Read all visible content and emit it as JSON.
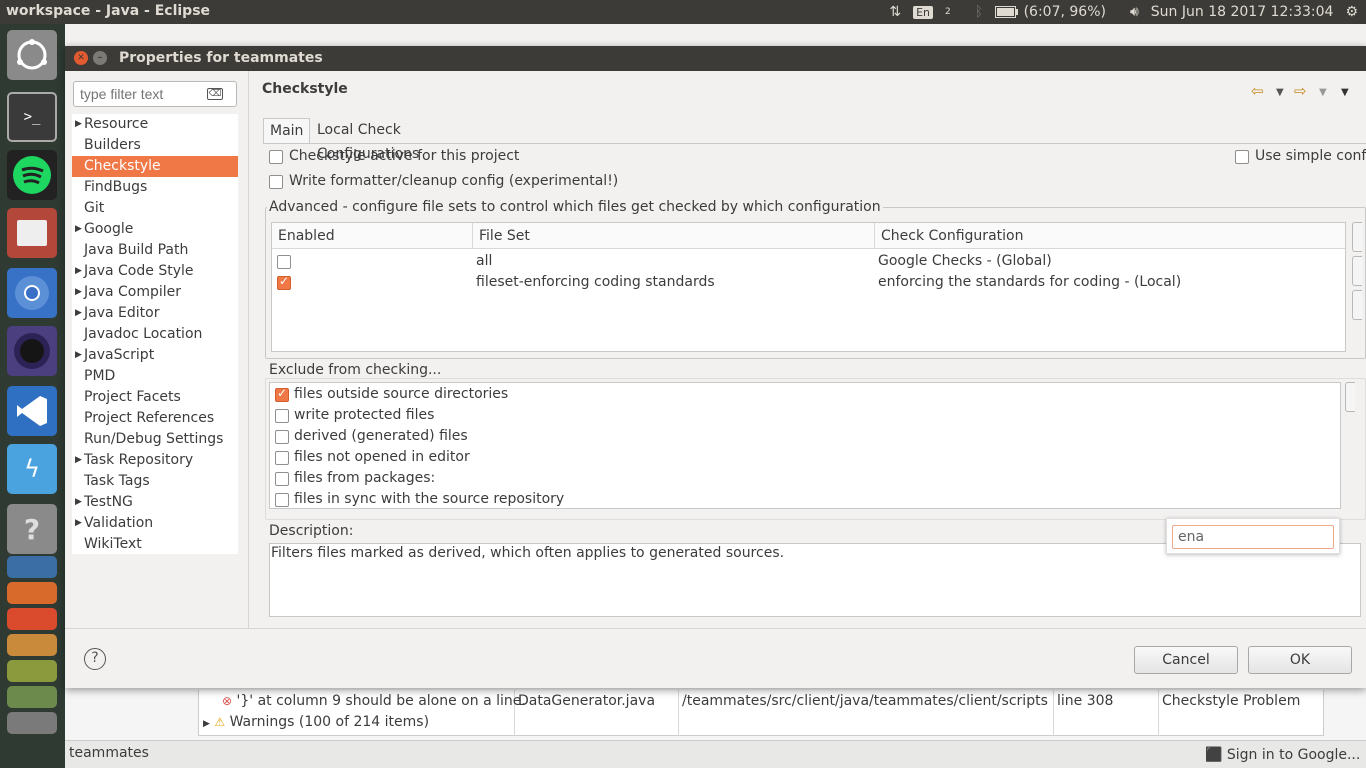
{
  "top_bar": {
    "window_title": "workspace - Java - Eclipse",
    "keyboard_layout": "En",
    "keyboard_sub": "2",
    "battery": "(6:07, 96%)",
    "datetime": "Sun Jun 18 2017 12:33:04"
  },
  "launcher": {
    "apps": [
      "ubuntu-dash-icon",
      "terminal-icon",
      "spotify-icon",
      "files-icon",
      "chromium-icon",
      "eclipse-icon",
      "vscode-icon",
      "storm-icon",
      "help-icon",
      "libreoffice-icon",
      "firefox-icon",
      "software-center-icon",
      "impress-icon",
      "settings-icon",
      "disk-icon",
      "trash-icon"
    ]
  },
  "dialog": {
    "title": "Properties for teammates",
    "filter_placeholder": "type filter text",
    "filter_clear": "⌫",
    "tree_items": [
      {
        "label": "Resource",
        "expandable": true
      },
      {
        "label": "Builders",
        "expandable": false
      },
      {
        "label": "Checkstyle",
        "expandable": false,
        "selected": true
      },
      {
        "label": "FindBugs",
        "expandable": false
      },
      {
        "label": "Git",
        "expandable": false
      },
      {
        "label": "Google",
        "expandable": true
      },
      {
        "label": "Java Build Path",
        "expandable": false
      },
      {
        "label": "Java Code Style",
        "expandable": true
      },
      {
        "label": "Java Compiler",
        "expandable": true
      },
      {
        "label": "Java Editor",
        "expandable": true
      },
      {
        "label": "Javadoc Location",
        "expandable": false
      },
      {
        "label": "JavaScript",
        "expandable": true
      },
      {
        "label": "PMD",
        "expandable": false
      },
      {
        "label": "Project Facets",
        "expandable": false
      },
      {
        "label": "Project References",
        "expandable": false
      },
      {
        "label": "Run/Debug Settings",
        "expandable": false
      },
      {
        "label": "Task Repository",
        "expandable": true
      },
      {
        "label": "Task Tags",
        "expandable": false
      },
      {
        "label": "TestNG",
        "expandable": true
      },
      {
        "label": "Validation",
        "expandable": true
      },
      {
        "label": "WikiText",
        "expandable": false
      }
    ],
    "page_title": "Checkstyle",
    "tabs": [
      "Main",
      "Local Check Configurations"
    ],
    "checkstyle_active": "Checkstyle active for this project",
    "write_formatter": "Write formatter/cleanup config (experimental!)",
    "use_simple": "Use simple conf",
    "advanced_group": "Advanced - configure file sets to control which files get checked by which configuration",
    "table_headers": [
      "Enabled",
      "File Set",
      "Check Configuration"
    ],
    "table_rows": [
      {
        "enabled": false,
        "fileset": "all",
        "config": "Google Checks  - (Global)"
      },
      {
        "enabled": true,
        "fileset": "fileset-enforcing coding standards",
        "config": "enforcing the standards for coding  - (Local)"
      }
    ],
    "exclude_group": "Exclude from checking...",
    "exclude_items": [
      {
        "label": "files outside source directories",
        "checked": true
      },
      {
        "label": "write protected files",
        "checked": false
      },
      {
        "label": "derived (generated) files",
        "checked": false
      },
      {
        "label": "files not opened in editor",
        "checked": false
      },
      {
        "label": "files from packages:",
        "checked": false
      },
      {
        "label": "files in sync with the source repository",
        "checked": false
      }
    ],
    "description_label": "Description:",
    "description_text": "Filters files marked as derived, which often applies to generated sources.",
    "popup_input": "ena",
    "cancel": "Cancel",
    "ok": "OK",
    "help": "?"
  },
  "problems": {
    "error_message": "'}' at column 9 should be alone on a line.",
    "resource": "DataGenerator.java",
    "path": "/teammates/src/client/java/teammates/client/scripts",
    "location": "line 308",
    "type": "Checkstyle Problem",
    "warnings": "Warnings (100 of 214 items)"
  },
  "status_bar": {
    "project": "teammates",
    "sign_in": "Sign in to Google..."
  },
  "colors": {
    "accent": "#f07746",
    "title_bar": "#3c3b37"
  }
}
